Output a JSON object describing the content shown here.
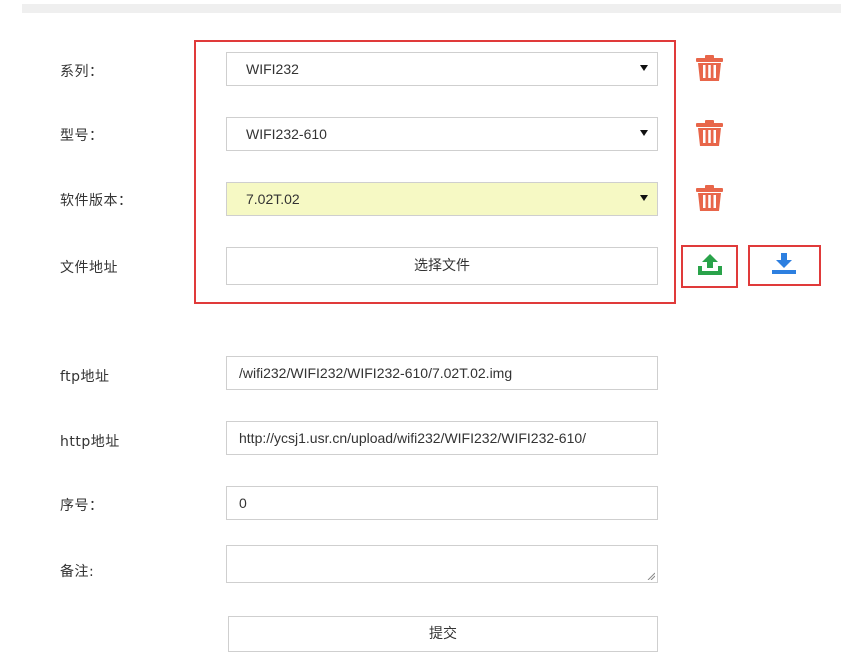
{
  "form": {
    "series": {
      "label": "系列：",
      "value": "WIFI232"
    },
    "model": {
      "label": "型号：",
      "value": "WIFI232-610"
    },
    "version": {
      "label": "软件版本：",
      "value": "7.02T.02"
    },
    "file": {
      "label": "文件地址",
      "button": "选择文件"
    },
    "ftp": {
      "label": "ftp地址",
      "value": "/wifi232/WIFI232/WIFI232-610/7.02T.02.img"
    },
    "http": {
      "label": "http地址",
      "value": "http://ycsj1.usr.cn/upload/wifi232/WIFI232/WIFI232-610/"
    },
    "order": {
      "label": "序号：",
      "value": "0"
    },
    "remark": {
      "label": "备注:",
      "value": ""
    },
    "submit": "提交"
  },
  "icons": {
    "delete": "trash-icon",
    "upload": "upload-icon",
    "download": "download-icon"
  },
  "colors": {
    "highlight_box": "#e03a3a",
    "delete_icon": "#e8664a",
    "upload_icon": "#2aa34a",
    "download_icon": "#2d7fe0",
    "version_bg": "#f6f9c4"
  }
}
